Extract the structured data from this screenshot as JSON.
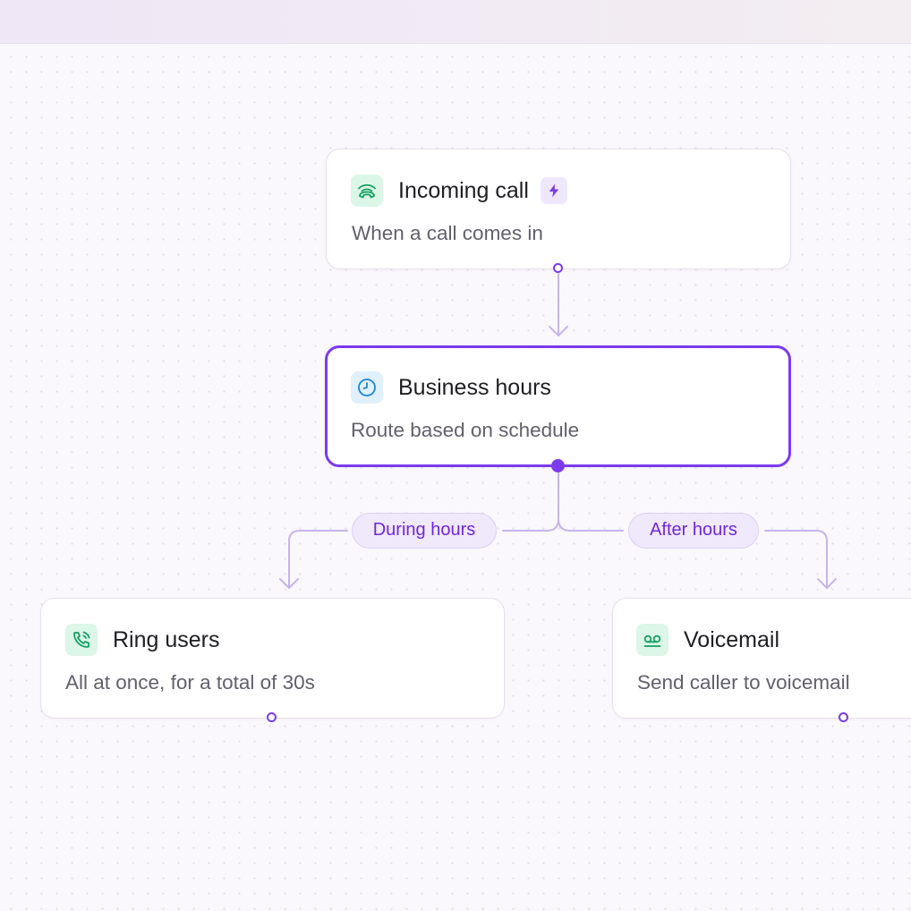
{
  "nodes": {
    "incoming_call": {
      "title": "Incoming call",
      "subtitle": "When a call comes in",
      "icon": "incoming-call-icon",
      "badge_icon": "lightning-bolt-icon"
    },
    "business_hours": {
      "title": "Business hours",
      "subtitle": "Route based on schedule",
      "icon": "clock-icon",
      "selected": true
    },
    "ring_users": {
      "title": "Ring users",
      "subtitle": "All at once, for a total of 30s",
      "icon": "phone-ringing-icon"
    },
    "voicemail": {
      "title": "Voicemail",
      "subtitle": "Send caller to voicemail",
      "icon": "voicemail-icon"
    }
  },
  "branches": {
    "during": "During hours",
    "after": "After hours"
  },
  "colors": {
    "accent": "#7c3aed",
    "connector": "#c8b4ec",
    "green_icon": "#16a063",
    "blue_icon": "#1a86d8",
    "muted_text": "#62606a"
  }
}
